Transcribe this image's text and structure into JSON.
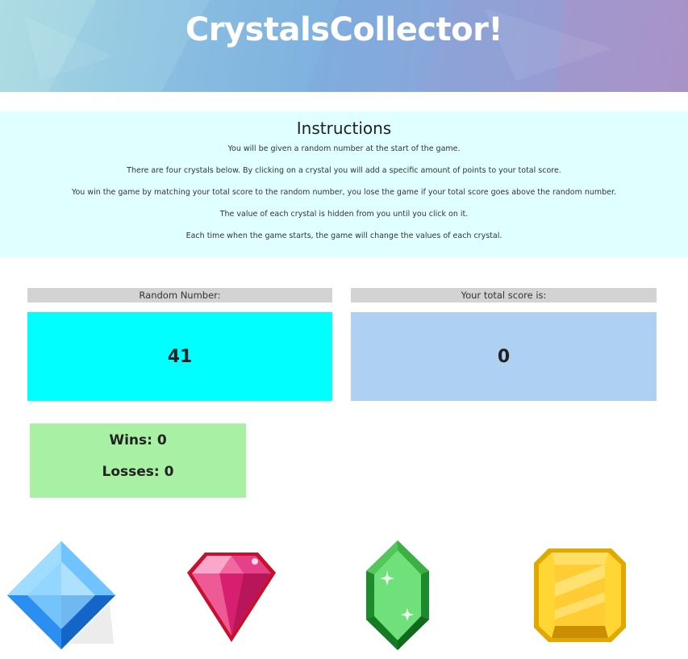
{
  "header": {
    "title": "CrystalsCollector!",
    "gradient_start": "#a9d9e0",
    "gradient_end": "#a792c8"
  },
  "instructions": {
    "heading": "Instructions",
    "lines": [
      "You will be given a random number at the start of the game.",
      "There are four crystals below. By clicking on a crystal you will add a specific amount of points to your total score.",
      "You win the game by matching your total score to the random number, you lose the game if your total score goes above the random number.",
      "The value of each crystal is hidden from you until you click on it.",
      "Each time when the game starts, the game will change the values of each crystal."
    ],
    "background": "#e0ffff"
  },
  "random": {
    "label": "Random Number:",
    "value": "41",
    "color": "#00ffff"
  },
  "score": {
    "label": "Your total score is:",
    "value": "0",
    "color": "#add0f3"
  },
  "record": {
    "wins": "Wins: 0",
    "losses": "Losses: 0",
    "color": "#a8f0a3"
  },
  "crystals": [
    {
      "name": "blue-crystal",
      "color": "#4aa8ff"
    },
    {
      "name": "pink-crystal",
      "color": "#e0307a"
    },
    {
      "name": "green-crystal",
      "color": "#3cb043"
    },
    {
      "name": "yellow-crystal",
      "color": "#f5c518"
    }
  ]
}
